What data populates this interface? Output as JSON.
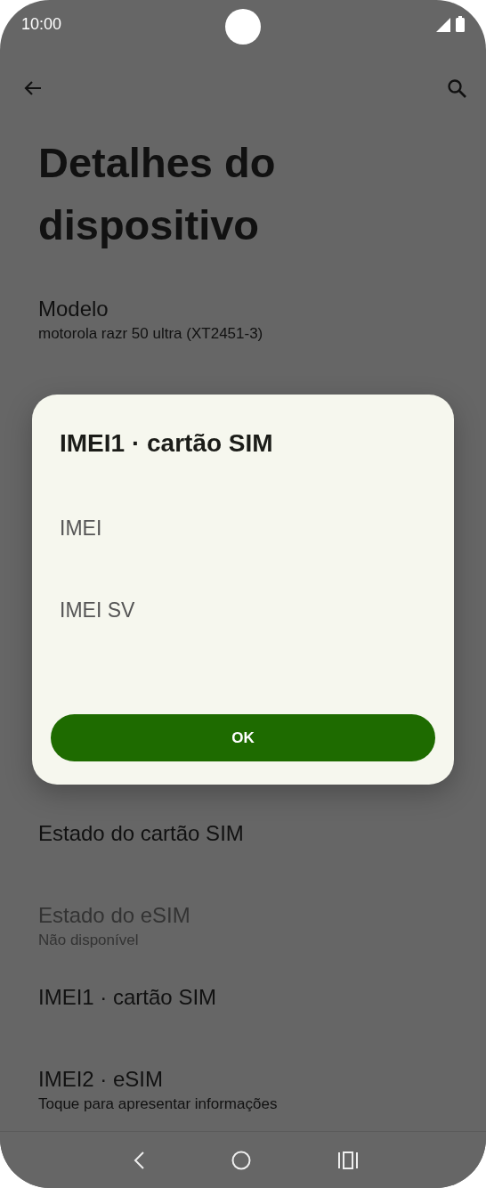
{
  "status_bar": {
    "time": "10:00"
  },
  "page": {
    "title": "Detalhes do dispositivo"
  },
  "settings": [
    {
      "title": "Modelo",
      "subtitle": "motorola razr 50 ultra (XT2451-3)",
      "disabled": false
    },
    {
      "title": "Estado do cartão SIM",
      "disabled": false
    },
    {
      "title": "Estado do eSIM",
      "subtitle": "Não disponível",
      "disabled": true
    },
    {
      "title": "IMEI1 · cartão SIM",
      "disabled": false
    },
    {
      "title": "IMEI2 · eSIM",
      "subtitle": "Toque para apresentar informações",
      "disabled": false
    }
  ],
  "dialog": {
    "title": "IMEI1 · cartão SIM",
    "items": [
      "IMEI",
      "IMEI SV"
    ],
    "button": "OK"
  }
}
